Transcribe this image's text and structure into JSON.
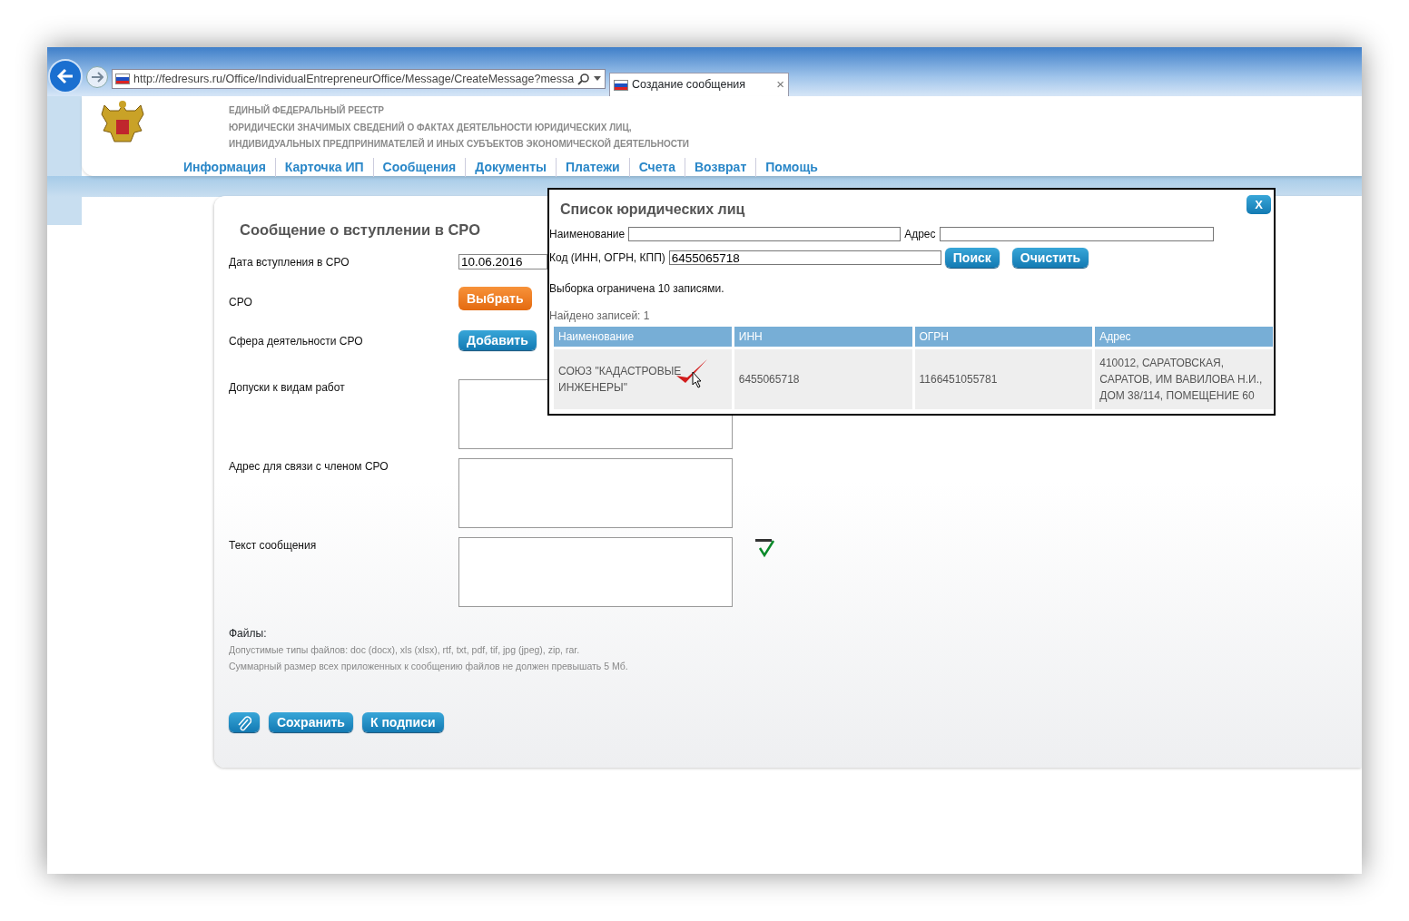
{
  "browser": {
    "address": "http://fedresurs.ru/Office/IndividualEntrepreneurOffice/Message/CreateMessage?messa",
    "tab_title": "Создание сообщения",
    "tab_close": "×"
  },
  "header": {
    "lines": [
      "ЕДИНЫЙ ФЕДЕРАЛЬНЫЙ РЕЕСТР",
      "ЮРИДИЧЕСКИ ЗНАЧИМЫХ СВЕДЕНИЙ О ФАКТАХ ДЕЯТЕЛЬНОСТИ ЮРИДИЧЕСКИХ ЛИЦ,",
      "ИНДИВИДУАЛЬНЫХ ПРЕДПРИНИМАТЕЛЕЙ И ИНЫХ СУБЪЕКТОВ ЭКОНОМИЧЕСКОЙ ДЕЯТЕЛЬНОСТИ"
    ],
    "nav": [
      "Информация",
      "Карточка ИП",
      "Сообщения",
      "Документы",
      "Платежи",
      "Счета",
      "Возврат",
      "Помощь"
    ]
  },
  "form": {
    "title": "Сообщение о вступлении в СРО",
    "fields": [
      {
        "kind": "input",
        "label": "Дата вступления в СРО",
        "value": "10.06.2016"
      },
      {
        "kind": "select_button",
        "label": "СРО",
        "button": "Выбрать"
      },
      {
        "kind": "button",
        "label": "Сфера деятельности СРО",
        "button": "Добавить"
      },
      {
        "kind": "textarea",
        "label": "Допуски к видам работ"
      },
      {
        "kind": "textarea",
        "label": "Адрес для связи с членом СРО"
      },
      {
        "kind": "textarea_spell",
        "label": "Текст сообщения"
      }
    ]
  },
  "files": {
    "label": "Файлы:",
    "notes": [
      "Допустимые типы файлов: doc (docx), xls (xlsx), rtf, txt, pdf, tif, jpg (jpeg), zip, rar.",
      "Суммарный размер всех приложенных к сообщению файлов не должен превышать 5 Мб."
    ]
  },
  "actions": [
    {
      "kind": "attach"
    },
    {
      "kind": "button",
      "label": "Сохранить"
    },
    {
      "kind": "button",
      "label": "К подписи"
    }
  ],
  "modal": {
    "title": "Список юридических лиц",
    "close": "X",
    "name_label": "Наименование",
    "address_label": "Адрес",
    "code_label": "Код (ИНН, ОГРН, КПП)",
    "code_value": "6455065718",
    "buttons": [
      "Поиск",
      "Очистить"
    ],
    "limit_note": "Выборка ограничена 10 записями.",
    "found": "Найдено записей: 1",
    "table": {
      "columns": [
        "Наименование",
        "ИНН",
        "ОГРН",
        "Адрес"
      ],
      "rows": [
        [
          "СОЮЗ \"КАДАСТРОВЫЕ ИНЖЕНЕРЫ\"",
          "6455065718",
          "1166451055781",
          "410012, САРАТОВСКАЯ, САРАТОВ, ИМ ВАВИЛОВА Н.И., ДОМ 38/114, ПОМЕЩЕНИЕ 60"
        ]
      ]
    }
  }
}
